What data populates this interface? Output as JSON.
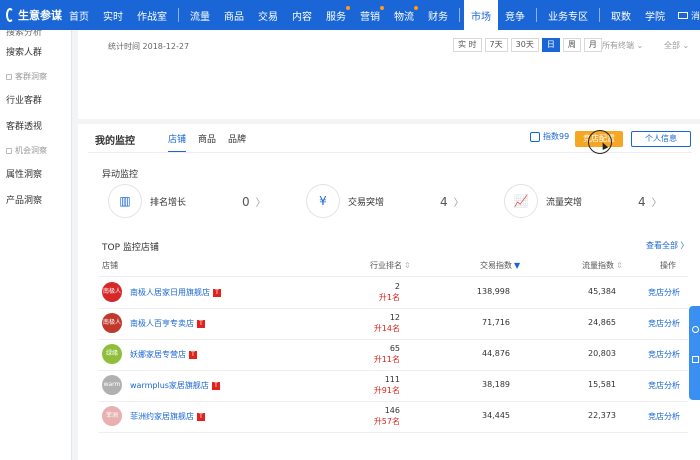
{
  "brand": {
    "logo_text": "生意参谋"
  },
  "nav": {
    "left_items": [
      "首页",
      "实时",
      "作战室",
      "流量",
      "商品",
      "交易",
      "内容",
      "服务",
      "营销",
      "物流",
      "财务"
    ],
    "active_items": [
      "市场",
      "竞争"
    ],
    "zone": "业务专区",
    "right_items": [
      "取数",
      "学院"
    ],
    "message": "消"
  },
  "sidebar": {
    "items": [
      {
        "label": "搜索分析",
        "kind": "cut"
      },
      {
        "label": "搜索人群",
        "kind": "item"
      },
      {
        "label": "客群洞察",
        "kind": "group"
      },
      {
        "label": "行业客群",
        "kind": "item"
      },
      {
        "label": "客群透视",
        "kind": "item"
      },
      {
        "label": "机会洞察",
        "kind": "group"
      },
      {
        "label": "属性洞察",
        "kind": "item"
      },
      {
        "label": "产品洞察",
        "kind": "item"
      }
    ]
  },
  "stats": {
    "time_label": "统计时间 2018-12-27",
    "ranges": [
      "实 时",
      "7天",
      "30天",
      "日",
      "周",
      "月"
    ],
    "selected_range": "日",
    "terminal": "所有终端",
    "scope": "全部"
  },
  "monitor": {
    "title": "我的监控",
    "tabs": [
      "店铺",
      "商品",
      "品牌"
    ],
    "active_tab": "店铺",
    "quota": "指数99",
    "btn_primary": "竞店配置",
    "btn_secondary": "个人信息"
  },
  "anomaly": {
    "title": "异动监控",
    "items": [
      {
        "icon": "bar-chart-icon",
        "glyph": "▥",
        "label": "排名增长",
        "value": "0"
      },
      {
        "icon": "yen-coin-icon",
        "glyph": "¥",
        "label": "交易突增",
        "value": "4"
      },
      {
        "icon": "trend-chart-icon",
        "glyph": "📈",
        "label": "流量突增",
        "value": "4"
      }
    ]
  },
  "top": {
    "title": "TOP 监控店铺",
    "see_all": "查看全部 〉",
    "columns": [
      "店铺",
      "行业排名",
      "交易指数",
      "流量指数",
      "操作"
    ],
    "rows": [
      {
        "logo": "南极人",
        "logo_color": "#d62828",
        "name": "南极人居家日用旗舰店",
        "rank": "2",
        "change": "升1名",
        "trade": "138,998",
        "traffic": "45,384",
        "action": "竞店分析"
      },
      {
        "logo": "南极人",
        "logo_color": "#c0392b",
        "name": "南极人百亨专卖店",
        "rank": "12",
        "change": "升14名",
        "trade": "71,716",
        "traffic": "24,865",
        "action": "竞店分析"
      },
      {
        "logo": "绿缘",
        "logo_color": "#8fbf3a",
        "name": "妖娜家居专营店",
        "rank": "65",
        "change": "升11名",
        "trade": "44,876",
        "traffic": "20,803",
        "action": "竞店分析"
      },
      {
        "logo": "warm",
        "logo_color": "#b0b0b0",
        "name": "warmplus家居旗舰店",
        "rank": "111",
        "change": "升91名",
        "trade": "38,189",
        "traffic": "15,581",
        "action": "竞店分析"
      },
      {
        "logo": "菲洲",
        "logo_color": "#e8b0b0",
        "name": "菲洲约家居旗舰店",
        "rank": "146",
        "change": "升57名",
        "trade": "34,445",
        "traffic": "22,373",
        "action": "竞店分析"
      }
    ]
  },
  "colors": {
    "brand_blue": "#1a66d6",
    "accent_orange": "#f5a623",
    "up_red": "#e0231d"
  }
}
